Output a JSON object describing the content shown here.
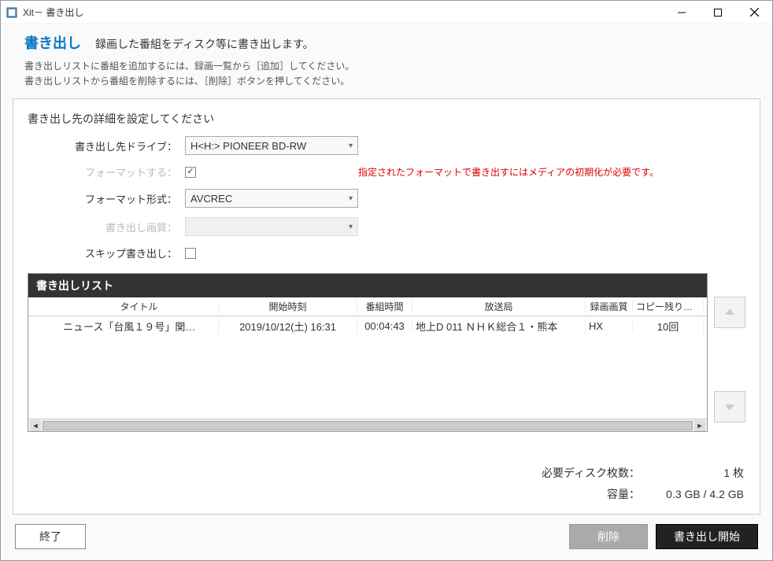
{
  "window": {
    "title": "Xit－ 書き出し"
  },
  "header": {
    "title": "書き出し",
    "subtitle": "録画した番組をディスク等に書き出します。"
  },
  "instructions": {
    "line1": "書き出しリストに番組を追加するには、録画一覧から［追加］してください。",
    "line2": "書き出しリストから番組を削除するには、［削除］ボタンを押してください。"
  },
  "section": {
    "title": "書き出し先の詳細を設定してください"
  },
  "form": {
    "drive_label": "書き出し先ドライブ：",
    "drive_value": "H<H:> PIONEER BD-RW",
    "format_do_label": "フォーマットする：",
    "format_do_checked": true,
    "warning": "指定されたフォーマットで書き出すにはメディアの初期化が必要です。",
    "format_type_label": "フォーマット形式：",
    "format_type_value": "AVCREC",
    "quality_label": "書き出し画質：",
    "skip_label": "スキップ書き出し：",
    "skip_checked": false
  },
  "list": {
    "header": "書き出しリスト",
    "columns": {
      "title": "タイトル",
      "start": "開始時刻",
      "duration": "番組時間",
      "broadcaster": "放送局",
      "rec_quality": "録画画質",
      "copy_count": "コピー残り回数"
    },
    "rows": [
      {
        "title": "ニュース「台風１９号」関…",
        "start": "2019/10/12(土)  16:31",
        "duration": "00:04:43",
        "broadcaster": "地上D  011  ＮＨＫ総合１・熊本",
        "rec_quality": "HX",
        "copy_count": "10回"
      }
    ]
  },
  "stats": {
    "discs_label": "必要ディスク枚数：",
    "discs_value": "1 枚",
    "capacity_label": "容量：",
    "capacity_value": "0.3 GB / 4.2 GB"
  },
  "buttons": {
    "exit": "終了",
    "delete": "削除",
    "start": "書き出し開始"
  }
}
